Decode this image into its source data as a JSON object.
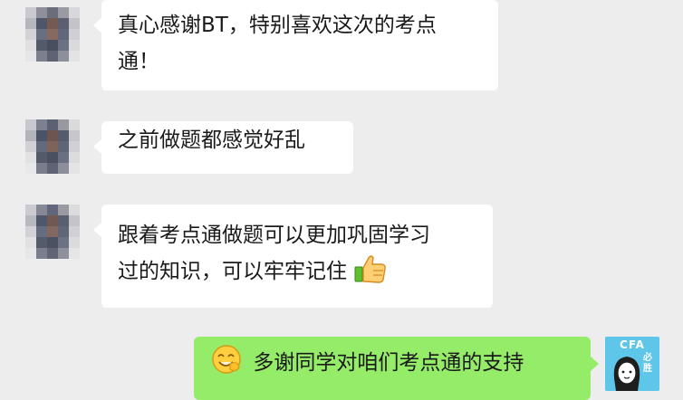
{
  "messages": [
    {
      "side": "left",
      "lines": [
        "真心感谢BT，特别喜欢这次的考点",
        "通！"
      ]
    },
    {
      "side": "left",
      "lines": [
        "之前做题都感觉好乱"
      ]
    },
    {
      "side": "left",
      "lines": [
        "跟着考点通做题可以更加巩固学习",
        "过的知识，可以牢牢记住"
      ],
      "emoji": "thumbs-up-emoji"
    },
    {
      "side": "right",
      "lines": [
        "多谢同学对咱们考点通的支持"
      ],
      "emoji": "laughing-hand-emoji"
    }
  ],
  "self_avatar": {
    "badge": "CFA",
    "side_text": "必胜"
  },
  "colors": {
    "background": "#ededed",
    "incoming_bubble": "#ffffff",
    "outgoing_bubble": "#95ec69",
    "self_avatar_bg": "#5ec6e8"
  }
}
